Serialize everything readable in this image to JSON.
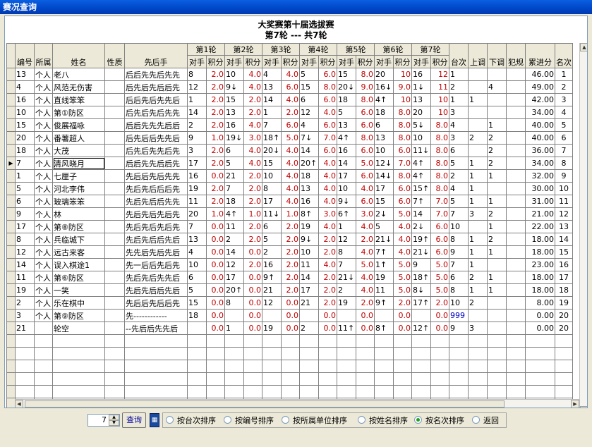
{
  "window": {
    "title": "赛况查询"
  },
  "header": {
    "line1": "大奖赛第十届选拔赛",
    "line2": "第7轮  ---  共7轮"
  },
  "columns": {
    "no": "编号",
    "unit": "所属",
    "name": "姓名",
    "nature": "性质",
    "order": "先后手",
    "rounds": [
      "第1轮",
      "第2轮",
      "第3轮",
      "第4轮",
      "第5轮",
      "第6轮",
      "第7轮"
    ],
    "opp": "对手",
    "score": "积分",
    "tai": "台次",
    "up": "上调",
    "down": "下调",
    "foul": "犯规",
    "cum": "累进分",
    "rank": "名次"
  },
  "rows": [
    {
      "no": "13",
      "unit": "个人",
      "name": "老八",
      "order": "后后先先后先先",
      "r": [
        [
          "8",
          "2.0"
        ],
        [
          "10",
          "4.0"
        ],
        [
          "4",
          "4.0"
        ],
        [
          "5",
          "6.0"
        ],
        [
          "15",
          "8.0"
        ],
        [
          "20",
          "10"
        ],
        [
          "16",
          "12"
        ]
      ],
      "tai": "1",
      "up": "",
      "down": "",
      "cum": "46.00",
      "rank": "1"
    },
    {
      "no": "4",
      "unit": "个人",
      "name": "风范无伤害",
      "order": "后先后先后后先",
      "r": [
        [
          "12",
          "2.0"
        ],
        [
          "9↓",
          "4.0"
        ],
        [
          "13",
          "6.0"
        ],
        [
          "15",
          "8.0"
        ],
        [
          "20↓",
          "9.0"
        ],
        [
          "16↓",
          "9.0"
        ],
        [
          "1↓",
          "11"
        ]
      ],
      "tai": "2",
      "up": "",
      "down": "4",
      "cum": "49.00",
      "rank": "2"
    },
    {
      "no": "16",
      "unit": "个人",
      "name": "直线笨笨",
      "order": "后后先后先先后",
      "r": [
        [
          "1",
          "2.0"
        ],
        [
          "15",
          "2.0"
        ],
        [
          "14",
          "4.0"
        ],
        [
          "6",
          "6.0"
        ],
        [
          "18",
          "8.0"
        ],
        [
          "4↑",
          "10"
        ],
        [
          "13",
          "10"
        ]
      ],
      "tai": "1",
      "up": "1",
      "down": "",
      "cum": "42.00",
      "rank": "3"
    },
    {
      "no": "10",
      "unit": "个人",
      "name": "第①防区",
      "order": "后先后先后先先",
      "r": [
        [
          "14",
          "2.0"
        ],
        [
          "13",
          "2.0"
        ],
        [
          "1",
          "2.0"
        ],
        [
          "12",
          "4.0"
        ],
        [
          "5",
          "6.0"
        ],
        [
          "18",
          "8.0"
        ],
        [
          "20",
          "10"
        ]
      ],
      "tai": "3",
      "up": "",
      "down": "",
      "cum": "34.00",
      "rank": "4"
    },
    {
      "no": "15",
      "unit": "个人",
      "name": "俊展福咏",
      "order": "后后先先先后后",
      "r": [
        [
          "2",
          "2.0"
        ],
        [
          "16",
          "4.0"
        ],
        [
          "7",
          "6.0"
        ],
        [
          "4",
          "6.0"
        ],
        [
          "13",
          "6.0"
        ],
        [
          "6",
          "8.0"
        ],
        [
          "5↓",
          "8.0"
        ]
      ],
      "tai": "4",
      "up": "",
      "down": "1",
      "cum": "40.00",
      "rank": "5"
    },
    {
      "no": "20",
      "unit": "个人",
      "name": "番薯超人",
      "order": "后先后后先先后",
      "r": [
        [
          "9",
          "1.0"
        ],
        [
          "19↓",
          "3.0"
        ],
        [
          "18↑",
          "5.0"
        ],
        [
          "7↓",
          "7.0"
        ],
        [
          "4↑",
          "8.0"
        ],
        [
          "13",
          "8.0"
        ],
        [
          "10",
          "8.0"
        ]
      ],
      "tai": "3",
      "up": "2",
      "down": "2",
      "cum": "40.00",
      "rank": "6"
    },
    {
      "no": "18",
      "unit": "个人",
      "name": "大茂",
      "order": "后先后先先后先",
      "r": [
        [
          "3",
          "2.0"
        ],
        [
          "6",
          "4.0"
        ],
        [
          "20↓",
          "4.0"
        ],
        [
          "14",
          "6.0"
        ],
        [
          "16",
          "6.0"
        ],
        [
          "10",
          "6.0"
        ],
        [
          "11↓",
          "8.0"
        ]
      ],
      "tai": "6",
      "up": "",
      "down": "2",
      "cum": "36.00",
      "rank": "7"
    },
    {
      "no": "7",
      "unit": "个人",
      "name": "清风晓月",
      "order": "后后先先后后先",
      "r": [
        [
          "17",
          "2.0"
        ],
        [
          "5",
          "4.0"
        ],
        [
          "15",
          "4.0"
        ],
        [
          "20↑",
          "4.0"
        ],
        [
          "14",
          "5.0"
        ],
        [
          "12↓",
          "7.0"
        ],
        [
          "4↑",
          "8.0"
        ]
      ],
      "tai": "5",
      "up": "1",
      "down": "2",
      "cum": "34.00",
      "rank": "8"
    },
    {
      "no": "1",
      "unit": "个人",
      "name": "七厘子",
      "order": "先后后先后先先",
      "r": [
        [
          "16",
          "0.0"
        ],
        [
          "21",
          "2.0"
        ],
        [
          "10",
          "4.0"
        ],
        [
          "18",
          "4.0"
        ],
        [
          "17",
          "6.0"
        ],
        [
          "14↓",
          "8.0"
        ],
        [
          "4↑",
          "8.0"
        ]
      ],
      "tai": "2",
      "up": "1",
      "down": "1",
      "cum": "32.00",
      "rank": "9"
    },
    {
      "no": "5",
      "unit": "个人",
      "name": "河北李伟",
      "order": "先后先后后后先",
      "r": [
        [
          "19",
          "2.0"
        ],
        [
          "7",
          "2.0"
        ],
        [
          "8",
          "4.0"
        ],
        [
          "13",
          "4.0"
        ],
        [
          "10",
          "4.0"
        ],
        [
          "17",
          "6.0"
        ],
        [
          "15↑",
          "8.0"
        ]
      ],
      "tai": "4",
      "up": "1",
      "down": "",
      "cum": "30.00",
      "rank": "10"
    },
    {
      "no": "6",
      "unit": "个人",
      "name": "玻璃笨笨",
      "order": "先后先后后先先",
      "r": [
        [
          "11",
          "2.0"
        ],
        [
          "18",
          "2.0"
        ],
        [
          "17",
          "4.0"
        ],
        [
          "16",
          "4.0"
        ],
        [
          "9↓",
          "6.0"
        ],
        [
          "15",
          "6.0"
        ],
        [
          "7↑",
          "7.0"
        ]
      ],
      "tai": "5",
      "up": "1",
      "down": "1",
      "cum": "31.00",
      "rank": "11"
    },
    {
      "no": "9",
      "unit": "个人",
      "name": "林",
      "order": "先后先后先后先",
      "r": [
        [
          "20",
          "1.0"
        ],
        [
          "4↑",
          "1.0"
        ],
        [
          "11↓",
          "1.0"
        ],
        [
          "8↑",
          "3.0"
        ],
        [
          "6↑",
          "3.0"
        ],
        [
          "2↓",
          "5.0"
        ],
        [
          "14",
          "7.0"
        ]
      ],
      "tai": "7",
      "up": "3",
      "down": "2",
      "cum": "21.00",
      "rank": "12"
    },
    {
      "no": "17",
      "unit": "个人",
      "name": "第⑧防区",
      "order": "先后先后先后先",
      "r": [
        [
          "7",
          "0.0"
        ],
        [
          "11",
          "2.0"
        ],
        [
          "6",
          "2.0"
        ],
        [
          "19",
          "4.0"
        ],
        [
          "1",
          "4.0"
        ],
        [
          "5",
          "4.0"
        ],
        [
          "2↓",
          "6.0"
        ]
      ],
      "tai": "10",
      "up": "",
      "down": "1",
      "cum": "22.00",
      "rank": "13"
    },
    {
      "no": "8",
      "unit": "个人",
      "name": "兵临城下",
      "order": "先后先后后先后",
      "r": [
        [
          "13",
          "0.0"
        ],
        [
          "2",
          "2.0"
        ],
        [
          "5",
          "2.0"
        ],
        [
          "9↓",
          "2.0"
        ],
        [
          "12",
          "2.0"
        ],
        [
          "21↓",
          "4.0"
        ],
        [
          "19↑",
          "6.0"
        ]
      ],
      "tai": "8",
      "up": "1",
      "down": "2",
      "cum": "18.00",
      "rank": "14"
    },
    {
      "no": "12",
      "unit": "个人",
      "name": "远古来客",
      "order": "先先后先后先后",
      "r": [
        [
          "4",
          "0.0"
        ],
        [
          "14",
          "0.0"
        ],
        [
          "2",
          "2.0"
        ],
        [
          "10",
          "2.0"
        ],
        [
          "8",
          "4.0"
        ],
        [
          "7↑",
          "4.0"
        ],
        [
          "21↓",
          "6.0"
        ]
      ],
      "tai": "9",
      "up": "1",
      "down": "1",
      "cum": "18.00",
      "rank": "15"
    },
    {
      "no": "14",
      "unit": "个人",
      "name": "误入棋途1",
      "order": "先一后后先后先",
      "r": [
        [
          "10",
          "0.0"
        ],
        [
          "12",
          "2.0"
        ],
        [
          "16",
          "2.0"
        ],
        [
          "11",
          "4.0"
        ],
        [
          "7",
          "5.0"
        ],
        [
          "1↑",
          "5.0"
        ],
        [
          "9",
          "5.0"
        ]
      ],
      "tai": "7",
      "up": "1",
      "down": "",
      "cum": "23.00",
      "rank": "16"
    },
    {
      "no": "11",
      "unit": "个人",
      "name": "第⑥防区",
      "order": "先后先后先先后",
      "r": [
        [
          "6",
          "0.0"
        ],
        [
          "17",
          "0.0"
        ],
        [
          "9↑",
          "2.0"
        ],
        [
          "14",
          "2.0"
        ],
        [
          "21↓",
          "4.0"
        ],
        [
          "19",
          "5.0"
        ],
        [
          "18↑",
          "5.0"
        ]
      ],
      "tai": "6",
      "up": "2",
      "down": "1",
      "cum": "18.00",
      "rank": "17"
    },
    {
      "no": "19",
      "unit": "个人",
      "name": "一笑",
      "order": "先后先后后先后",
      "r": [
        [
          "5",
          "0.0"
        ],
        [
          "20↑",
          "0.0"
        ],
        [
          "21",
          "2.0"
        ],
        [
          "17",
          "2.0"
        ],
        [
          "2",
          "4.0"
        ],
        [
          "11",
          "5.0"
        ],
        [
          "8↓",
          "5.0"
        ]
      ],
      "tai": "8",
      "up": "1",
      "down": "1",
      "cum": "18.00",
      "rank": "18"
    },
    {
      "no": "2",
      "unit": "个人",
      "name": "乐在棋中",
      "order": "先后后先后后先",
      "r": [
        [
          "15",
          "0.0"
        ],
        [
          "8",
          "0.0"
        ],
        [
          "12",
          "0.0"
        ],
        [
          "21",
          "2.0"
        ],
        [
          "19",
          "2.0"
        ],
        [
          "9↑",
          "2.0"
        ],
        [
          "17↑",
          "2.0"
        ]
      ],
      "tai": "10",
      "up": "2",
      "down": "",
      "cum": "8.00",
      "rank": "19"
    },
    {
      "no": "3",
      "unit": "个人",
      "name": "第⑨防区",
      "order": "先------------",
      "r": [
        [
          "18",
          "0.0"
        ],
        [
          "",
          "0.0"
        ],
        [
          "",
          "0.0"
        ],
        [
          "",
          "0.0"
        ],
        [
          "",
          "0.0"
        ],
        [
          "",
          "0.0"
        ],
        [
          "",
          "0.0"
        ]
      ],
      "tai": "999",
      "up": "",
      "down": "",
      "cum": "0.00",
      "rank": "20"
    },
    {
      "no": "21",
      "unit": "",
      "name": "轮空",
      "order": "--先后后先先后",
      "r": [
        [
          "",
          "0.0"
        ],
        [
          "1",
          "0.0"
        ],
        [
          "19",
          "0.0"
        ],
        [
          "2",
          "0.0"
        ],
        [
          "11↑",
          "0.0"
        ],
        [
          "8↑",
          "0.0"
        ],
        [
          "12↑",
          "0.0"
        ]
      ],
      "tai": "9",
      "up": "3",
      "down": "",
      "cum": "0.00",
      "rank": "20"
    }
  ],
  "selected_row": 7,
  "controls": {
    "round_value": "7",
    "query_label": "查询",
    "sort_options": [
      "按台次排序",
      "按编号排序",
      "按所属单位排序",
      "按姓名排序",
      "按名次排序",
      "返回"
    ],
    "selected_sort": 4
  },
  "colors": {
    "score": "#c00000",
    "tai_special": "#0000c0",
    "titlebar": "#0046c8"
  }
}
